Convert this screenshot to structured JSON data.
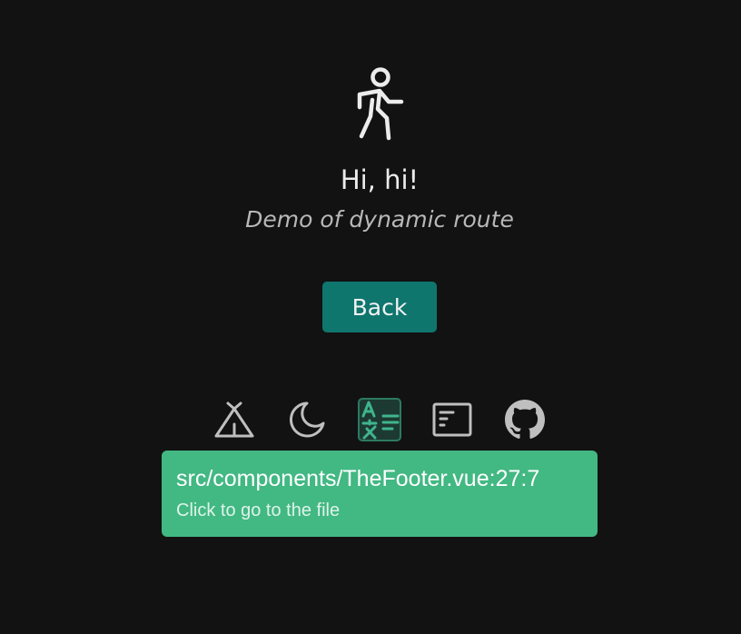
{
  "hero": {
    "icon": "pedestrian-walking-icon",
    "greeting": "Hi, hi!",
    "subtitle": "Demo of dynamic route"
  },
  "actions": {
    "back_label": "Back",
    "accent_color": "#0f766e"
  },
  "footer": {
    "icons": [
      "tent-icon",
      "moon-icon",
      "translate-icon",
      "browser-window-icon",
      "github-icon"
    ]
  },
  "tooltip": {
    "path": "src/components/TheFooter.vue:27:7",
    "hint": "Click to go to the file",
    "color": "#42b883"
  }
}
